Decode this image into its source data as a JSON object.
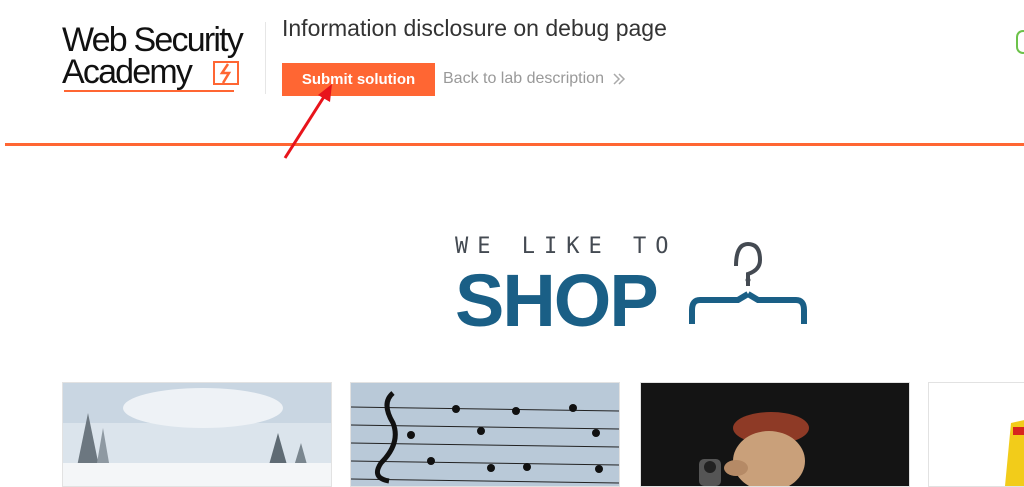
{
  "logo": {
    "line1": "Web Security",
    "line2": "Academy"
  },
  "lab": {
    "title": "Information disclosure on debug page",
    "submit_label": "Submit solution",
    "back_label": "Back to lab description"
  },
  "hero": {
    "small": "WE LIKE TO",
    "big": "SHOP"
  },
  "colors": {
    "accent": "#ff6633",
    "brand_blue": "#1a5f86"
  },
  "products": [
    {
      "icon": "snowy-forest-image"
    },
    {
      "icon": "music-notes-birds-image"
    },
    {
      "icon": "old-man-camera-image"
    },
    {
      "icon": "yellow-product-image"
    }
  ]
}
